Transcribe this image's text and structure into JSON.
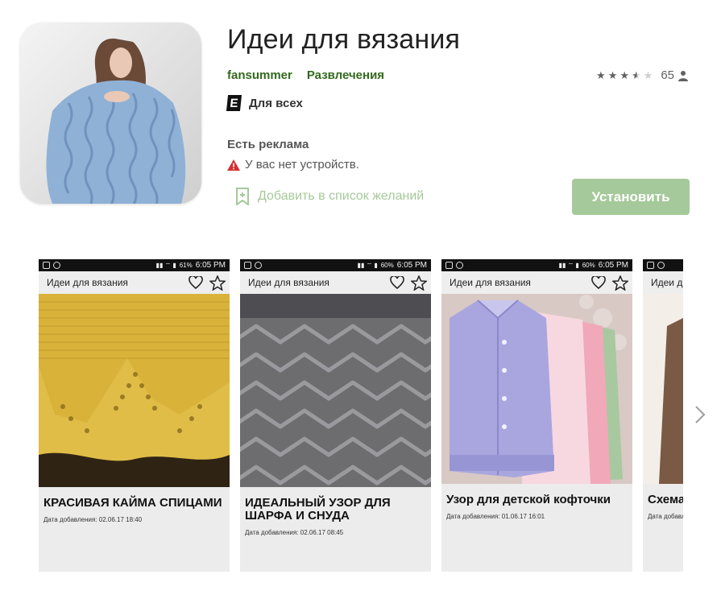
{
  "app": {
    "title": "Идеи для вязания",
    "developer": "fansummer",
    "category": "Развлечения",
    "rating_value": 3.5,
    "rating_count": "65",
    "audience": "Для всех",
    "esrb_letter": "E",
    "ads_notice": "Есть реклама",
    "device_warning": "У вас нет устройств.",
    "wishlist_label": "Добавить в список желаний",
    "install_label": "Установить",
    "colors": {
      "brand_green": "#33691e",
      "button_disabled": "#a5c99a",
      "warning_red": "#d32f2f"
    }
  },
  "screenshots": [
    {
      "status_time": "6:05 PM",
      "battery": "61%",
      "appbar_title": "Идеи для вязания",
      "caption": "КРАСИВАЯ КАЙМА СПИЦАМИ",
      "date": "Дата добавления: 02.06.17 18:40"
    },
    {
      "status_time": "6:05 PM",
      "battery": "60%",
      "appbar_title": "Идеи для вязания",
      "caption": "ИДЕАЛЬНЫЙ УЗОР ДЛЯ ШАРФА И СНУДА",
      "date": "Дата добавления: 02.06.17 08:45"
    },
    {
      "status_time": "6:05 PM",
      "battery": "60%",
      "appbar_title": "Идеи для вязания",
      "caption": "Узор для детской кофточки",
      "date": "Дата добавления: 01.06.17 16:01"
    },
    {
      "status_time": "",
      "battery": "",
      "appbar_title": "Идеи д",
      "caption": "Схема",
      "date": "Дата добавления"
    }
  ]
}
